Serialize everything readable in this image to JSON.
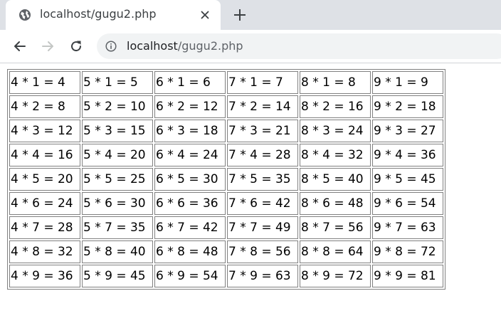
{
  "browser": {
    "tab_title": "localhost/gugu2.php",
    "url_host": "localhost",
    "url_path": "/gugu2.php",
    "icons": {
      "favicon": "globe-icon",
      "close": "close-icon",
      "new_tab": "plus-icon",
      "back": "arrow-left-icon",
      "forward": "arrow-right-icon",
      "reload": "reload-icon",
      "info": "info-icon"
    },
    "colors": {
      "tabstrip": "#dee1e6",
      "omnibox": "#f1f3f4",
      "forward_disabled": "#c4c7c5"
    }
  },
  "table": {
    "rows": [
      [
        "4 * 1 = 4",
        "5 * 1 = 5",
        "6 * 1 = 6",
        "7 * 1 = 7",
        "8 * 1 = 8",
        "9 * 1 = 9"
      ],
      [
        "4 * 2 = 8",
        "5 * 2 = 10",
        "6 * 2 = 12",
        "7 * 2 = 14",
        "8 * 2 = 16",
        "9 * 2 = 18"
      ],
      [
        "4 * 3 = 12",
        "5 * 3 = 15",
        "6 * 3 = 18",
        "7 * 3 = 21",
        "8 * 3 = 24",
        "9 * 3 = 27"
      ],
      [
        "4 * 4 = 16",
        "5 * 4 = 20",
        "6 * 4 = 24",
        "7 * 4 = 28",
        "8 * 4 = 32",
        "9 * 4 = 36"
      ],
      [
        "4 * 5 = 20",
        "5 * 5 = 25",
        "6 * 5 = 30",
        "7 * 5 = 35",
        "8 * 5 = 40",
        "9 * 5 = 45"
      ],
      [
        "4 * 6 = 24",
        "5 * 6 = 30",
        "6 * 6 = 36",
        "7 * 6 = 42",
        "8 * 6 = 48",
        "9 * 6 = 54"
      ],
      [
        "4 * 7 = 28",
        "5 * 7 = 35",
        "6 * 7 = 42",
        "7 * 7 = 49",
        "8 * 7 = 56",
        "9 * 7 = 63"
      ],
      [
        "4 * 8 = 32",
        "5 * 8 = 40",
        "6 * 8 = 48",
        "7 * 8 = 56",
        "8 * 8 = 64",
        "9 * 8 = 72"
      ],
      [
        "4 * 9 = 36",
        "5 * 9 = 45",
        "6 * 9 = 54",
        "7 * 9 = 63",
        "8 * 9 = 72",
        "9 * 9 = 81"
      ]
    ]
  }
}
